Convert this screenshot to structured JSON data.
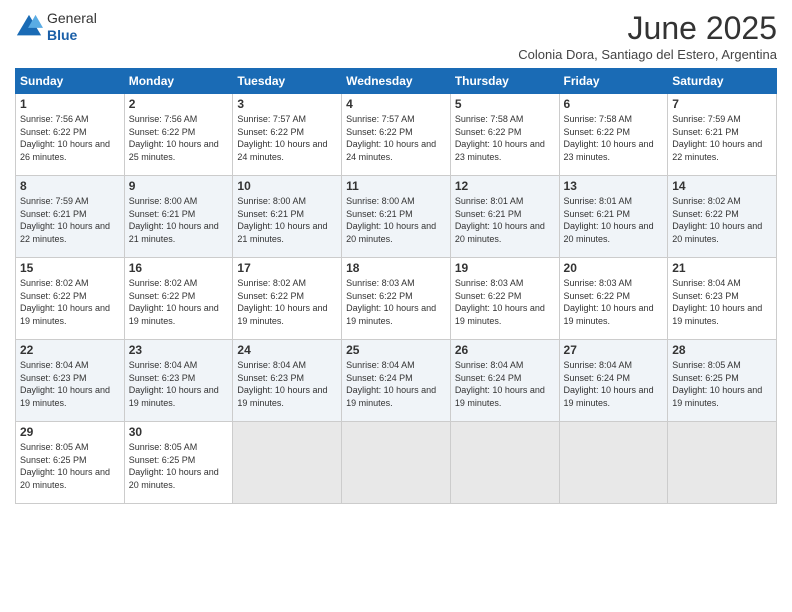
{
  "logo": {
    "general": "General",
    "blue": "Blue"
  },
  "title": "June 2025",
  "subtitle": "Colonia Dora, Santiago del Estero, Argentina",
  "days": [
    "Sunday",
    "Monday",
    "Tuesday",
    "Wednesday",
    "Thursday",
    "Friday",
    "Saturday"
  ],
  "weeks": [
    [
      {
        "day": 1,
        "sunrise": "7:56 AM",
        "sunset": "6:22 PM",
        "daylight": "10 hours and 26 minutes."
      },
      {
        "day": 2,
        "sunrise": "7:56 AM",
        "sunset": "6:22 PM",
        "daylight": "10 hours and 25 minutes."
      },
      {
        "day": 3,
        "sunrise": "7:57 AM",
        "sunset": "6:22 PM",
        "daylight": "10 hours and 24 minutes."
      },
      {
        "day": 4,
        "sunrise": "7:57 AM",
        "sunset": "6:22 PM",
        "daylight": "10 hours and 24 minutes."
      },
      {
        "day": 5,
        "sunrise": "7:58 AM",
        "sunset": "6:22 PM",
        "daylight": "10 hours and 23 minutes."
      },
      {
        "day": 6,
        "sunrise": "7:58 AM",
        "sunset": "6:22 PM",
        "daylight": "10 hours and 23 minutes."
      },
      {
        "day": 7,
        "sunrise": "7:59 AM",
        "sunset": "6:21 PM",
        "daylight": "10 hours and 22 minutes."
      }
    ],
    [
      {
        "day": 8,
        "sunrise": "7:59 AM",
        "sunset": "6:21 PM",
        "daylight": "10 hours and 22 minutes."
      },
      {
        "day": 9,
        "sunrise": "8:00 AM",
        "sunset": "6:21 PM",
        "daylight": "10 hours and 21 minutes."
      },
      {
        "day": 10,
        "sunrise": "8:00 AM",
        "sunset": "6:21 PM",
        "daylight": "10 hours and 21 minutes."
      },
      {
        "day": 11,
        "sunrise": "8:00 AM",
        "sunset": "6:21 PM",
        "daylight": "10 hours and 20 minutes."
      },
      {
        "day": 12,
        "sunrise": "8:01 AM",
        "sunset": "6:21 PM",
        "daylight": "10 hours and 20 minutes."
      },
      {
        "day": 13,
        "sunrise": "8:01 AM",
        "sunset": "6:21 PM",
        "daylight": "10 hours and 20 minutes."
      },
      {
        "day": 14,
        "sunrise": "8:02 AM",
        "sunset": "6:22 PM",
        "daylight": "10 hours and 20 minutes."
      }
    ],
    [
      {
        "day": 15,
        "sunrise": "8:02 AM",
        "sunset": "6:22 PM",
        "daylight": "10 hours and 19 minutes."
      },
      {
        "day": 16,
        "sunrise": "8:02 AM",
        "sunset": "6:22 PM",
        "daylight": "10 hours and 19 minutes."
      },
      {
        "day": 17,
        "sunrise": "8:02 AM",
        "sunset": "6:22 PM",
        "daylight": "10 hours and 19 minutes."
      },
      {
        "day": 18,
        "sunrise": "8:03 AM",
        "sunset": "6:22 PM",
        "daylight": "10 hours and 19 minutes."
      },
      {
        "day": 19,
        "sunrise": "8:03 AM",
        "sunset": "6:22 PM",
        "daylight": "10 hours and 19 minutes."
      },
      {
        "day": 20,
        "sunrise": "8:03 AM",
        "sunset": "6:22 PM",
        "daylight": "10 hours and 19 minutes."
      },
      {
        "day": 21,
        "sunrise": "8:04 AM",
        "sunset": "6:23 PM",
        "daylight": "10 hours and 19 minutes."
      }
    ],
    [
      {
        "day": 22,
        "sunrise": "8:04 AM",
        "sunset": "6:23 PM",
        "daylight": "10 hours and 19 minutes."
      },
      {
        "day": 23,
        "sunrise": "8:04 AM",
        "sunset": "6:23 PM",
        "daylight": "10 hours and 19 minutes."
      },
      {
        "day": 24,
        "sunrise": "8:04 AM",
        "sunset": "6:23 PM",
        "daylight": "10 hours and 19 minutes."
      },
      {
        "day": 25,
        "sunrise": "8:04 AM",
        "sunset": "6:24 PM",
        "daylight": "10 hours and 19 minutes."
      },
      {
        "day": 26,
        "sunrise": "8:04 AM",
        "sunset": "6:24 PM",
        "daylight": "10 hours and 19 minutes."
      },
      {
        "day": 27,
        "sunrise": "8:04 AM",
        "sunset": "6:24 PM",
        "daylight": "10 hours and 19 minutes."
      },
      {
        "day": 28,
        "sunrise": "8:05 AM",
        "sunset": "6:25 PM",
        "daylight": "10 hours and 19 minutes."
      }
    ],
    [
      {
        "day": 29,
        "sunrise": "8:05 AM",
        "sunset": "6:25 PM",
        "daylight": "10 hours and 20 minutes."
      },
      {
        "day": 30,
        "sunrise": "8:05 AM",
        "sunset": "6:25 PM",
        "daylight": "10 hours and 20 minutes."
      },
      null,
      null,
      null,
      null,
      null
    ]
  ]
}
